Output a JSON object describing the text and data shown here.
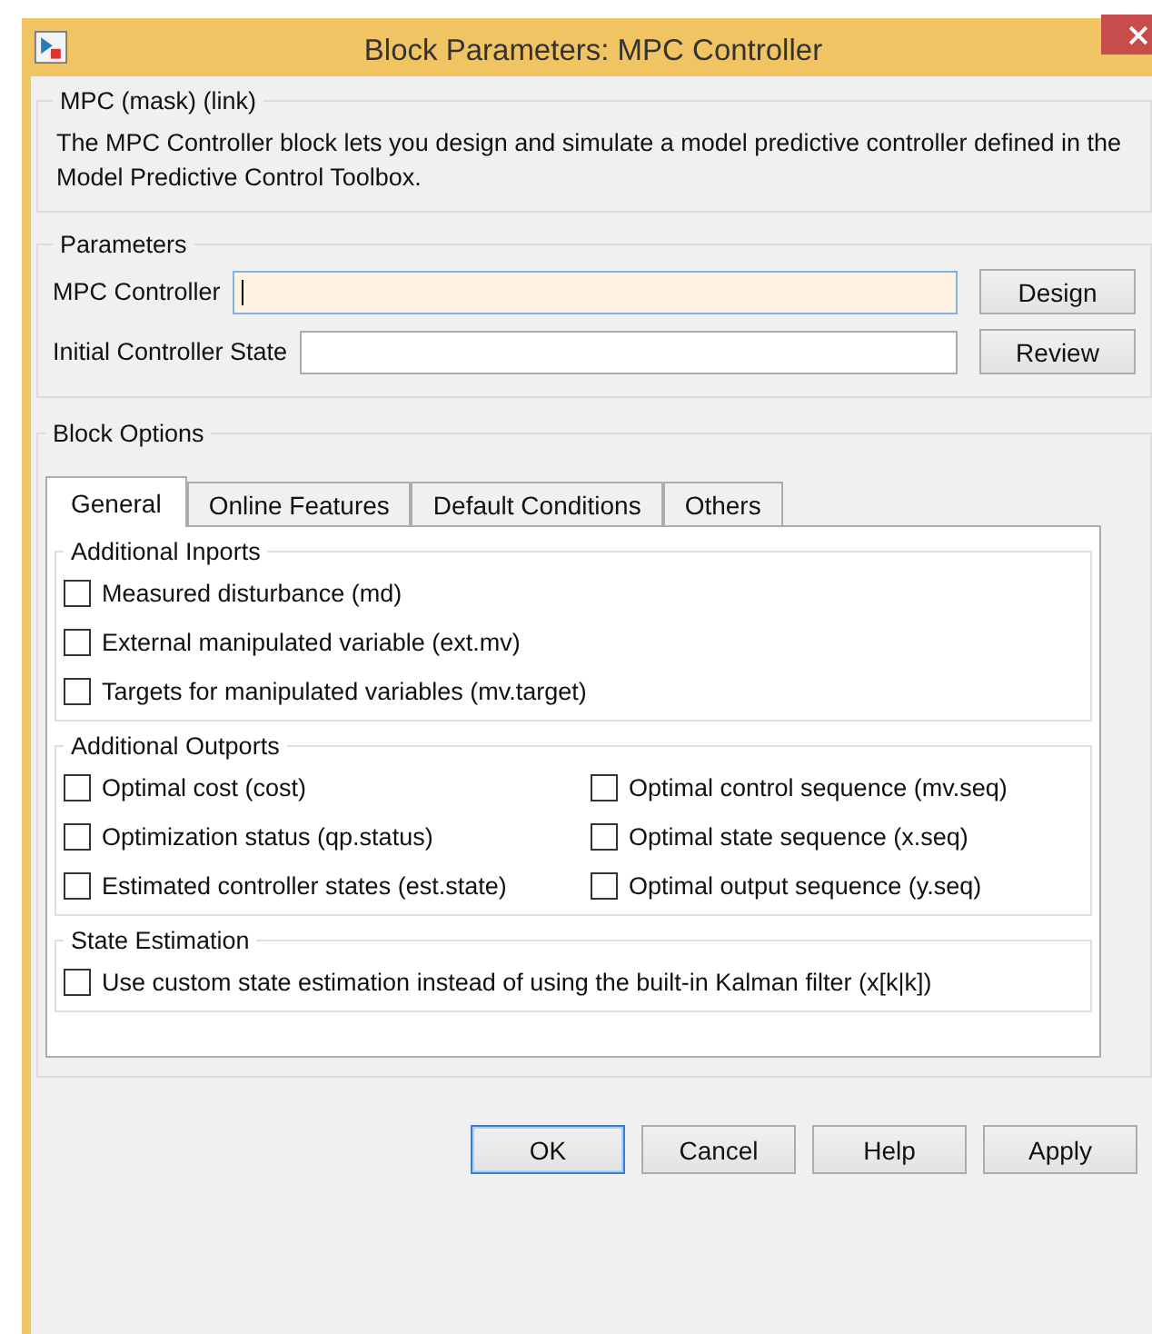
{
  "window": {
    "title": "Block Parameters: MPC Controller"
  },
  "mask": {
    "title": "MPC (mask) (link)",
    "description": "The MPC Controller block lets you design and simulate a model predictive controller defined in the Model Predictive Control Toolbox."
  },
  "parameters": {
    "title": "Parameters",
    "fields": [
      {
        "label": "MPC Controller",
        "focused": true,
        "button": "Design"
      },
      {
        "label": "Initial Controller State",
        "focused": false,
        "button": "Review"
      }
    ]
  },
  "block_options": {
    "title": "Block Options",
    "tabs": [
      {
        "label": "General",
        "selected": true
      },
      {
        "label": "Online Features",
        "selected": false
      },
      {
        "label": "Default Conditions",
        "selected": false
      },
      {
        "label": "Others",
        "selected": false
      }
    ],
    "groups": [
      {
        "title": "Additional Inports",
        "kind": "one-column",
        "options": [
          {
            "label": "Measured disturbance (md)",
            "checked": false
          },
          {
            "label": "External manipulated variable (ext.mv)",
            "checked": false
          },
          {
            "label": "Targets for manipulated variables (mv.target)",
            "checked": false
          }
        ]
      },
      {
        "title": "Additional Outports",
        "kind": "two-column",
        "options": [
          {
            "label": "Optimal cost (cost)",
            "checked": false
          },
          {
            "label": "Optimal control sequence (mv.seq)",
            "checked": false
          },
          {
            "label": "Optimization status (qp.status)",
            "checked": false
          },
          {
            "label": "Optimal state sequence (x.seq)",
            "checked": false
          },
          {
            "label": "Estimated controller states (est.state)",
            "checked": false
          },
          {
            "label": "Optimal output sequence (y.seq)",
            "checked": false
          }
        ]
      },
      {
        "title": "State Estimation",
        "kind": "one-column",
        "options": [
          {
            "label": "Use custom state estimation instead of using the built-in Kalman filter (x[k|k])",
            "checked": false
          }
        ]
      }
    ]
  },
  "buttons": [
    {
      "label": "OK",
      "default": true
    },
    {
      "label": "Cancel",
      "default": false
    },
    {
      "label": "Help",
      "default": false
    },
    {
      "label": "Apply",
      "default": false
    }
  ]
}
